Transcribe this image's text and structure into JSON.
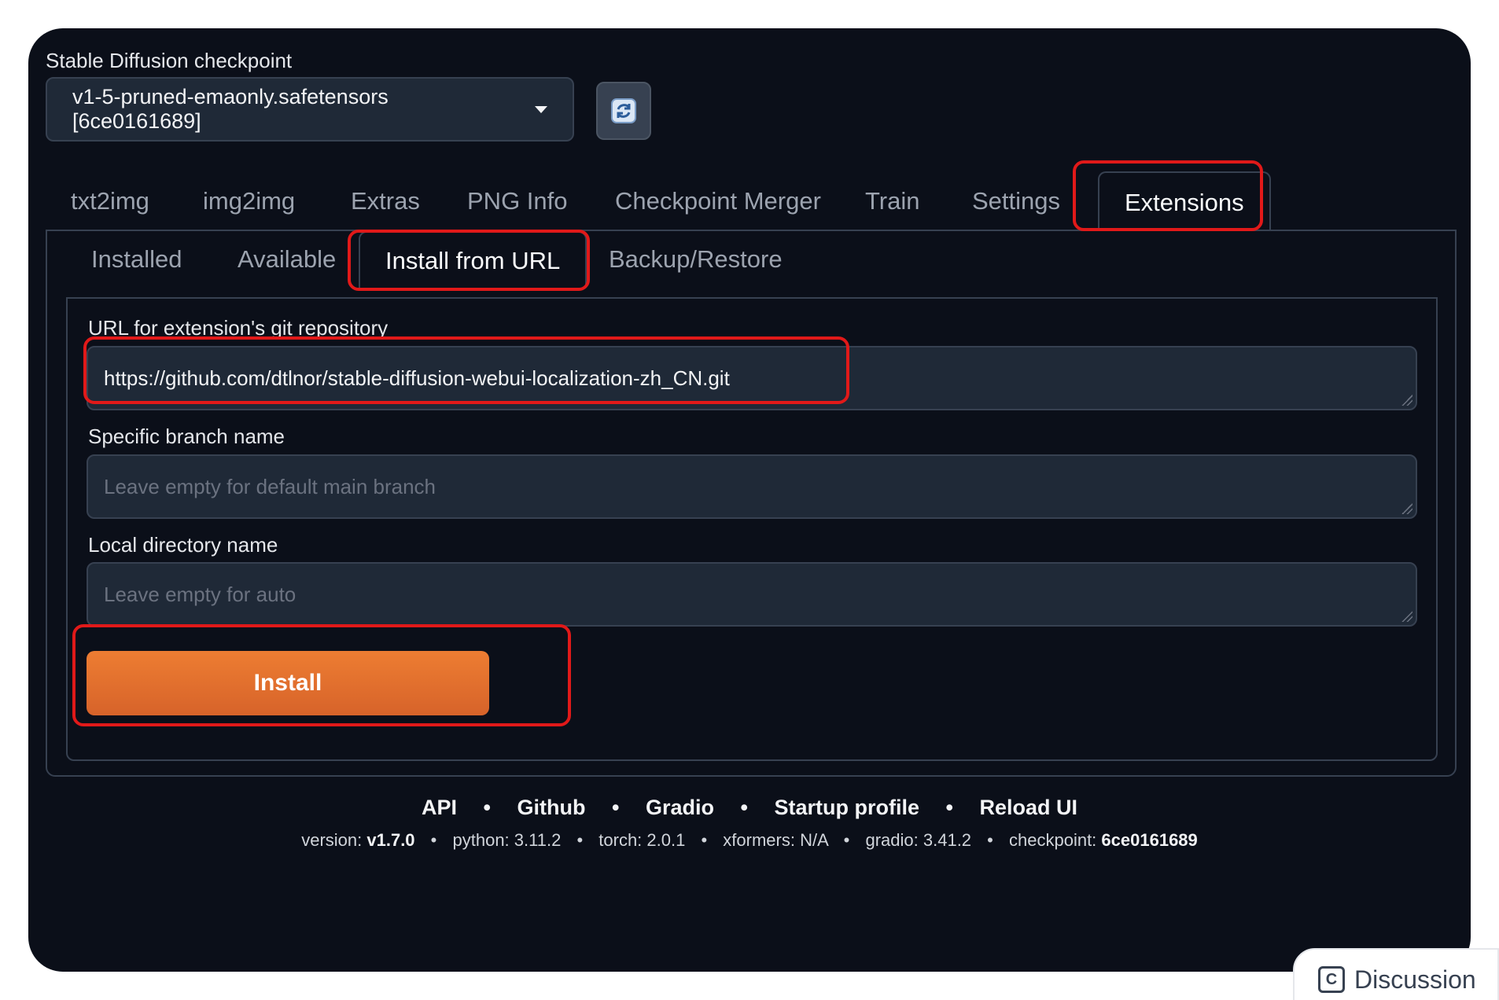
{
  "checkpoint": {
    "label": "Stable Diffusion checkpoint",
    "selected": "v1-5-pruned-emaonly.safetensors [6ce0161689]"
  },
  "main_tabs": [
    {
      "label": "txt2img"
    },
    {
      "label": "img2img"
    },
    {
      "label": "Extras"
    },
    {
      "label": "PNG Info"
    },
    {
      "label": "Checkpoint Merger"
    },
    {
      "label": "Train"
    },
    {
      "label": "Settings"
    },
    {
      "label": "Extensions",
      "active": true
    }
  ],
  "sub_tabs": [
    {
      "label": "Installed"
    },
    {
      "label": "Available"
    },
    {
      "label": "Install from URL",
      "active": true
    },
    {
      "label": "Backup/Restore"
    }
  ],
  "form": {
    "url_label": "URL for extension's git repository",
    "url_value": "https://github.com/dtlnor/stable-diffusion-webui-localization-zh_CN.git",
    "branch_label": "Specific branch name",
    "branch_placeholder": "Leave empty for default main branch",
    "dir_label": "Local directory name",
    "dir_placeholder": "Leave empty for auto",
    "install_label": "Install"
  },
  "footer": {
    "links": [
      "API",
      "Github",
      "Gradio",
      "Startup profile",
      "Reload UI"
    ],
    "separator": "•",
    "meta": {
      "version_label": "version:",
      "version": "v1.7.0",
      "python": "python: 3.11.2",
      "torch": "torch: 2.0.1",
      "xformers": "xformers: N/A",
      "gradio": "gradio: 3.41.2",
      "checkpoint_label": "checkpoint:",
      "checkpoint": "6ce0161689"
    }
  },
  "discussion": {
    "label": "Discussion"
  },
  "colors": {
    "background": "#0b0f19",
    "input_bg": "#1f2937",
    "accent": "#e8732e",
    "highlight": "#e11919"
  }
}
